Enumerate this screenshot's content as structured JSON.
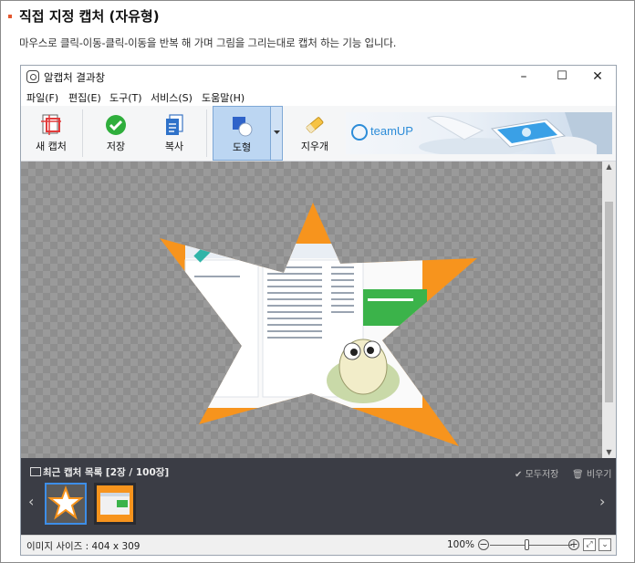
{
  "header": {
    "title": "직접 지정 캡처 (자유형)",
    "description": "마우스로 클릭-이동-클릭-이동을 반복 해 가며 그림을 그리는대로 캡처 하는 기능 입니다."
  },
  "window": {
    "title": "알캡처 결과창",
    "minimize": "–",
    "maximize": "☐",
    "close": "✕"
  },
  "menu": [
    "파일(F)",
    "편집(E)",
    "도구(T)",
    "서비스(S)",
    "도움말(H)"
  ],
  "toolbar": {
    "new_capture": "새 캡처",
    "save": "저장",
    "copy": "복사",
    "shape": "도형",
    "eraser": "지우개",
    "ad_brand": "teamUP"
  },
  "recent": {
    "title": "최근 캡처 목록 [2장 / 100장]",
    "save_all": "모두저장",
    "clear": "비우기"
  },
  "status": {
    "image_size": "이미지 사이즈 : 404 x 309",
    "zoom": "100%"
  },
  "colors": {
    "accent": "#e4572e",
    "recent_bg": "#3b3d45",
    "shape_active": "#bcd6f2",
    "star_orange": "#f7941d",
    "brand_blue": "#2c8cd8"
  }
}
